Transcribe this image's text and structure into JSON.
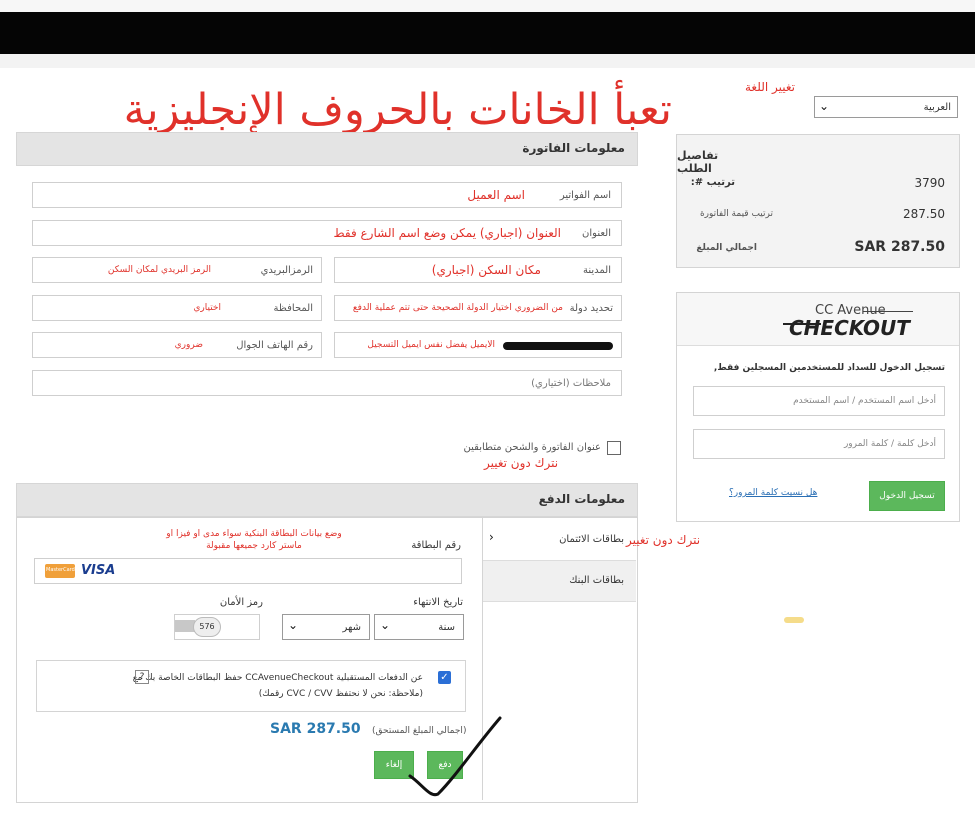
{
  "headline": "تعبأ الخانات بالحروف الإنجليزية",
  "language": {
    "label": "تغيير اللغة",
    "selected": "العربية"
  },
  "billing": {
    "title": "معلومات الفاتورة",
    "name_label": "اسم الفواتير",
    "name_note": "اسم العميل",
    "address_label": "العنوان",
    "address_note": "العنوان (اجباري) يمكن وضع اسم الشارع فقط",
    "city_label": "المدينة",
    "city_note": "مكان السكن (اجباري)",
    "zip_label": "الرمزالبريدي",
    "zip_note": "الرمز البريدي لمكان السكن",
    "country_label": "تحديد دولة",
    "country_note": "من الضروري اختيار الدولة الصحيحة حتى تتم عملية الدفع",
    "state_label": "المحافظة",
    "state_note": "اختياري",
    "email_note": "الايميل يفضل نفس ايميل التسجيل",
    "phone_label": "رقم الهاتف الجوال",
    "phone_note": "ضروري",
    "notes_placeholder": "(ملاحظات (اختياري",
    "shipping_same_label": "عنوان الفاتورة والشحن متطابقين",
    "shipping_note": "نترك دون تغيير"
  },
  "order": {
    "title": "تفاصيل الطلب",
    "order_num_label": ":# ترتيب",
    "order_num": "3790",
    "invoice_label": "ترتيب قيمة الفاتورة",
    "invoice_value": "287.50",
    "total_label": "اجمالي المبلغ",
    "total_value": "SAR 287.50"
  },
  "login": {
    "brand_top": "CC Avenue",
    "brand_bottom": "CHECKOUT",
    "intro": ",تسجيل الدخول للسداد للمستخدمين المسجلين فقط",
    "user_placeholder": "أدخل اسم المستخدم / اسم المستخدم",
    "pass_placeholder": "أدخل كلمة / كلمة المرور",
    "login_button": "تسجيل الدخول",
    "forgot_link": "هل نسيت كلمة المرور؟"
  },
  "payment": {
    "title": "معلومات الدفع",
    "tab_credit": "بطاقات الائتمان",
    "tab_credit_note": "نترك دون تغيير",
    "tab_bank": "بطاقات البنك",
    "card_number_label": "رقم البطاقة",
    "card_note_line1": "وضع بيانات البطاقة البنكية سواء مدى او فيزا او",
    "card_note_line2": "ماستر كارد جميعها مقبولة",
    "visa_text": "VISA",
    "mastercard_text": "MasterCard",
    "expiry_label": "تاريخ الانتهاء",
    "year_option": "سنة",
    "month_option": "شهر",
    "cvv_label": "رمز الأمان",
    "cvv_hint": "576",
    "save_card_line1": "حفظ البطاقات الخاصة بك مع CCAvenueCheckout عن الدفعات المستقبلية",
    "save_card_line2": "(رقمك CVC / CVV ملاحظة: نحن لا نحتفظ)",
    "help_icon_text": "?",
    "total_due_label": "(اجمالي المبلغ المستحق)",
    "total_due_value": "SAR 287.50",
    "pay_button": "دفع",
    "cancel_button": "إلغاء"
  },
  "colors": {
    "accent_red": "#e0312a",
    "button_green": "#5cb85c",
    "amount_blue": "#2a7ab0"
  }
}
